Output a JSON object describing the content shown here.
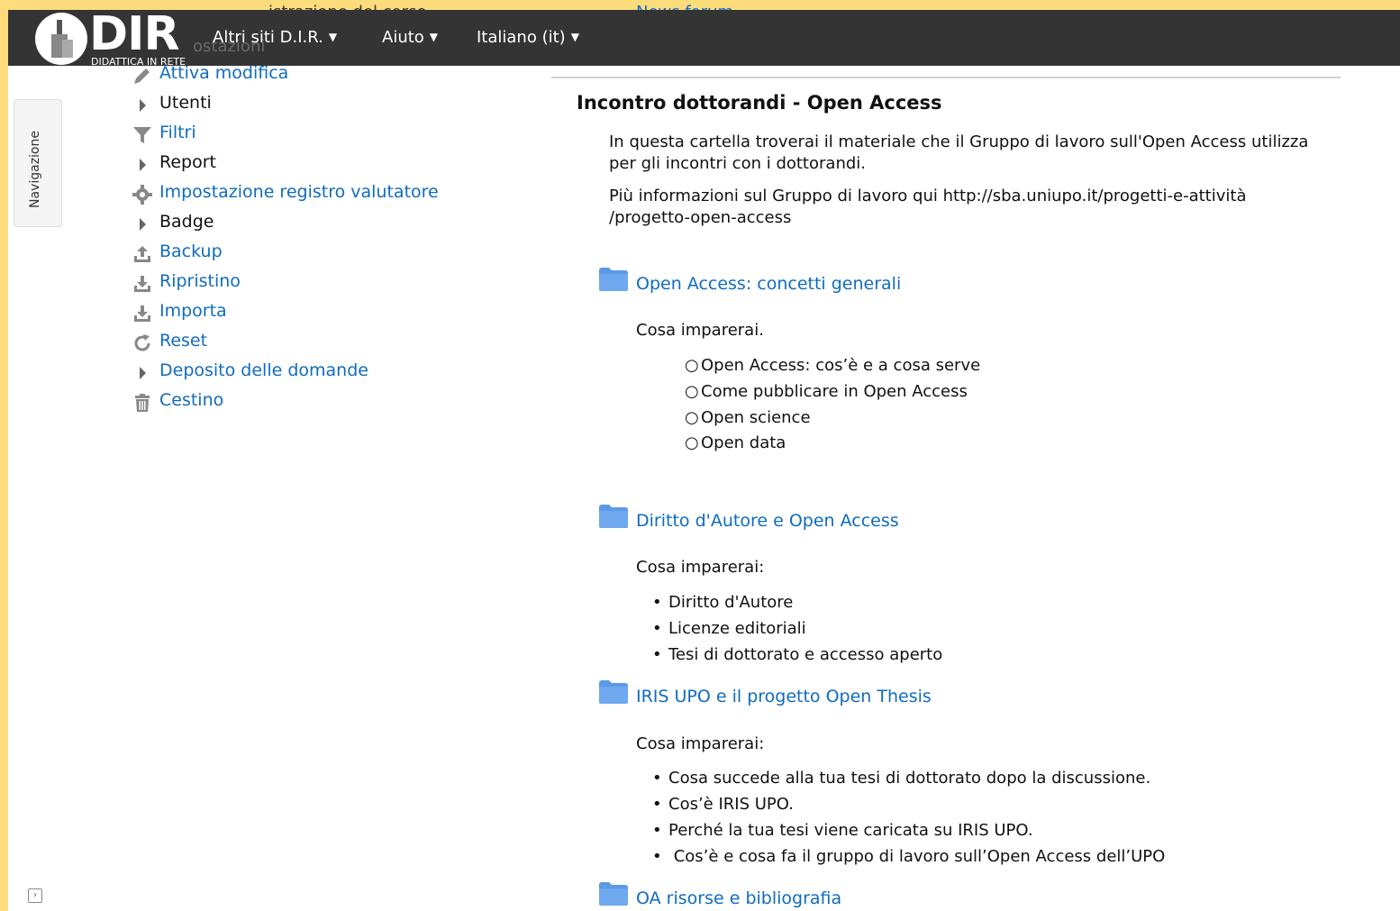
{
  "behind_navbar": {
    "admin_header": "istrazione del corso",
    "settings_peek": "ostazioni",
    "news_forum": "News forum"
  },
  "navbar": {
    "logo_text": "DIR",
    "logo_subtitle": "DIDATTICA IN RETE",
    "menus": [
      {
        "label": "Altri siti D.I.R."
      },
      {
        "label": "Aiuto"
      },
      {
        "label": "Italiano (it)"
      }
    ]
  },
  "drawer": {
    "label": "Navigazione"
  },
  "admin_menu": {
    "items": [
      {
        "label": "Attiva modifica",
        "icon": "pencil-icon",
        "link": true
      },
      {
        "label": "Utenti",
        "icon": "caret-right-icon",
        "link": false
      },
      {
        "label": "Filtri",
        "icon": "filter-icon",
        "link": true
      },
      {
        "label": "Report",
        "icon": "caret-right-icon",
        "link": false
      },
      {
        "label": "Impostazione registro valutatore",
        "icon": "gear-icon",
        "link": true
      },
      {
        "label": "Badge",
        "icon": "caret-right-icon",
        "link": false
      },
      {
        "label": "Backup",
        "icon": "upload-icon",
        "link": true
      },
      {
        "label": "Ripristino",
        "icon": "download-icon",
        "link": true
      },
      {
        "label": "Importa",
        "icon": "download-icon",
        "link": true
      },
      {
        "label": "Reset",
        "icon": "refresh-icon",
        "link": true
      },
      {
        "label": "Deposito delle domande",
        "icon": "caret-right-icon",
        "link": true
      },
      {
        "label": "Cestino",
        "icon": "trash-icon",
        "link": true
      }
    ]
  },
  "section": {
    "title": "Incontro dottorandi - Open Access",
    "summary": [
      "In questa cartella troverai il materiale che il Gruppo di lavoro sull'Open Access utilizza per gli incontri con i dottorandi.",
      "Più informazioni sul Gruppo di lavoro qui http://sba.uniupo.it/progetti-e-attività /progetto-open-access"
    ]
  },
  "activities": [
    {
      "title": "Open Access: concetti generali",
      "intro": "Cosa imparerai.",
      "bullet_style": "circle",
      "items": [
        "Open Access: cos’è e a cosa serve",
        "Come pubblicare in Open Access",
        "Open science",
        "Open data"
      ]
    },
    {
      "title": "Diritto d'Autore e Open Access",
      "intro": "Cosa imparerai:",
      "bullet_style": "disc",
      "items": [
        "Diritto d'Autore",
        "Licenze editoriali",
        "Tesi di dottorato e accesso aperto"
      ]
    },
    {
      "title": "IRIS UPO e il progetto Open Thesis",
      "intro": "Cosa imparerai:",
      "bullet_style": "disc",
      "items": [
        "Cosa succede alla tua tesi di dottorato dopo la discussione.",
        "Cos’è IRIS UPO.",
        "Perché la tua tesi viene caricata su IRIS UPO.",
        " Cos’è e cosa fa il gruppo di lavoro sull’Open Access dell’UPO"
      ]
    },
    {
      "title": "OA risorse e bibliografia"
    }
  ],
  "colors": {
    "link": "#0f6cbf",
    "navbar": "#343434",
    "frame": "#fddc7b",
    "folder": "#5b9ae6"
  }
}
